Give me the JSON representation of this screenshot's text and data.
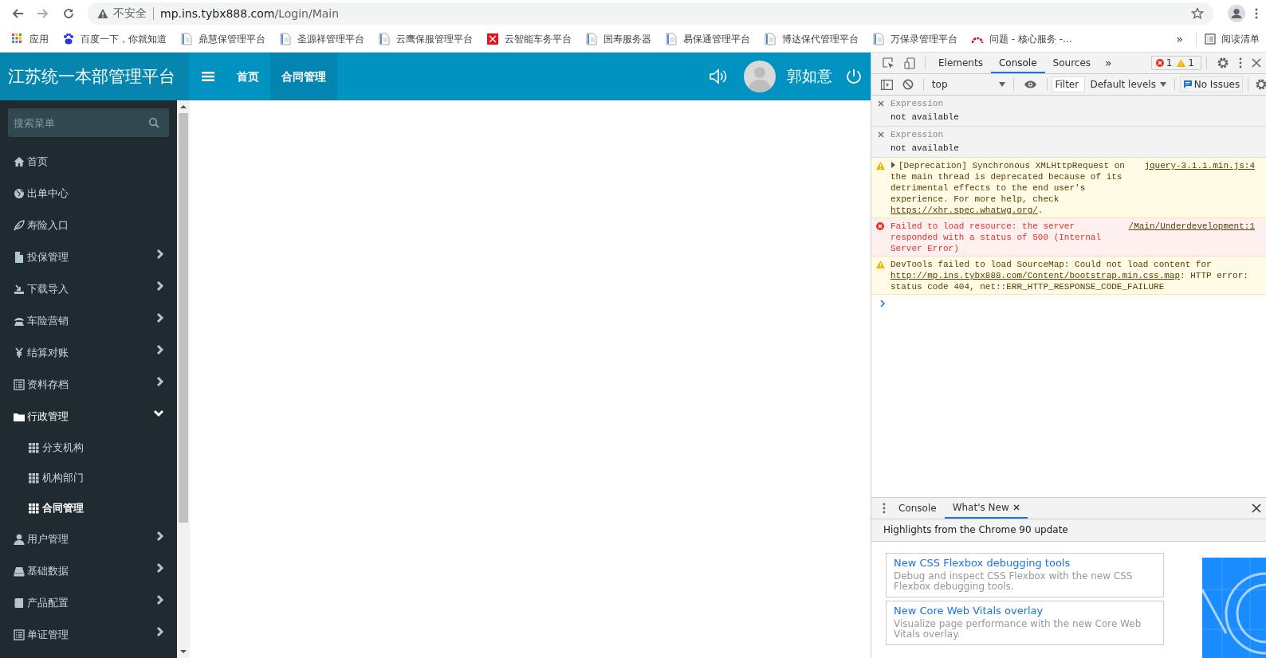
{
  "browser": {
    "nav_buttons": [
      {
        "kind": "back",
        "disabled": false
      },
      {
        "kind": "forward",
        "disabled": true
      },
      {
        "kind": "reload",
        "disabled": false
      }
    ],
    "address_bar": {
      "security_label": "不安全",
      "host": "mp.ins.tybx888.com",
      "path": "/Login/Main"
    },
    "bookmarks": [
      {
        "label": "应用",
        "kind": "apps"
      },
      {
        "label": "百度一下，你就知道",
        "kind": "paw"
      },
      {
        "label": "鼎慧保管理平台",
        "kind": "page"
      },
      {
        "label": "圣源祥管理平台",
        "kind": "page"
      },
      {
        "label": "云鹰保服管理平台",
        "kind": "page"
      },
      {
        "label": "云智能车务平台",
        "kind": "cross"
      },
      {
        "label": "国寿服务器",
        "kind": "page"
      },
      {
        "label": "易保通管理平台",
        "kind": "page"
      },
      {
        "label": "博达保代管理平台",
        "kind": "page"
      },
      {
        "label": "万保录管理平台",
        "kind": "page"
      },
      {
        "label": "问题 - 核心服务 -...",
        "kind": "arc"
      }
    ],
    "bookmarks_overflow": "»",
    "reading_list": "阅读清单"
  },
  "app": {
    "title": "江苏统一本部管理平台",
    "nav": [
      {
        "label": "首页",
        "selected": false
      },
      {
        "label": "合同管理",
        "selected": true
      }
    ],
    "user": {
      "name": "郭如意"
    },
    "sidebar": {
      "search_placeholder": "搜索菜单",
      "items": [
        {
          "label": "首页",
          "kind": "home",
          "expandable": false,
          "expanded": false
        },
        {
          "label": "出单中心",
          "kind": "globe",
          "expandable": false,
          "expanded": false
        },
        {
          "label": "寿险入口",
          "kind": "leaf",
          "expandable": false,
          "expanded": false
        },
        {
          "label": "投保管理",
          "kind": "file",
          "expandable": true,
          "expanded": false
        },
        {
          "label": "下载导入",
          "kind": "download",
          "expandable": true,
          "expanded": false
        },
        {
          "label": "车险营销",
          "kind": "phone",
          "expandable": true,
          "expanded": false
        },
        {
          "label": "结算对账",
          "kind": "yen",
          "expandable": true,
          "expanded": false
        },
        {
          "label": "资料存档",
          "kind": "list",
          "expandable": true,
          "expanded": false
        },
        {
          "label": "行政管理",
          "kind": "folder",
          "expandable": true,
          "expanded": true,
          "children": [
            {
              "label": "分支机构",
              "selected": false
            },
            {
              "label": "机构部门",
              "selected": false
            },
            {
              "label": "合同管理",
              "selected": true
            }
          ]
        },
        {
          "label": "用户管理",
          "kind": "user",
          "expandable": true,
          "expanded": false
        },
        {
          "label": "基础数据",
          "kind": "drive",
          "expandable": true,
          "expanded": false
        },
        {
          "label": "产品配置",
          "kind": "book",
          "expandable": true,
          "expanded": false
        },
        {
          "label": "单证管理",
          "kind": "list",
          "expandable": true,
          "expanded": false
        }
      ]
    }
  },
  "devtools": {
    "tabs": [
      {
        "label": "Elements",
        "selected": false
      },
      {
        "label": "Console",
        "selected": true
      },
      {
        "label": "Sources",
        "selected": false
      }
    ],
    "more_tabs": "»",
    "error_count": "1",
    "warning_count": "1",
    "context": "top",
    "filter_placeholder": "Filter",
    "levels": "Default levels",
    "issues": "No Issues",
    "live_expressions": [
      {
        "label": "Expression",
        "value": "not available"
      },
      {
        "label": "Expression",
        "value": "not available"
      }
    ],
    "messages": [
      {
        "kind": "warning",
        "expandable": true,
        "source": "jquery-3.1.1.min.js:4",
        "text": "[Deprecation] Synchronous XMLHttpRequest on the main thread is deprecated because of its detrimental effects to the end user's experience. For more help, check ",
        "link": "https://xhr.spec.whatwg.org/",
        "after": "."
      },
      {
        "kind": "error",
        "expandable": false,
        "source": "/Main/Underdevelopment:1",
        "text": "Failed to load resource: the server responded with a status of 500 (Internal Server Error)"
      },
      {
        "kind": "warning",
        "expandable": false,
        "text": "DevTools failed to load SourceMap: Could not load content for ",
        "link": "http://mp.ins.tybx888.com/Content/bootstrap.min.css.map",
        "after": ": HTTP error: status code 404, net::ERR_HTTP_RESPONSE_CODE_FAILURE"
      }
    ],
    "drawer": {
      "tabs": [
        {
          "label": "Console",
          "selected": false,
          "closable": false
        },
        {
          "label": "What's New",
          "selected": true,
          "closable": true
        }
      ],
      "heading": "Highlights from the Chrome 90 update",
      "cards": [
        {
          "title": "New CSS Flexbox debugging tools",
          "description": "Debug and inspect CSS Flexbox with the new CSS Flexbox debugging tools."
        },
        {
          "title": "New Core Web Vitals overlay",
          "description": "Visualize page performance with the new Core Web Vitals overlay."
        }
      ]
    }
  }
}
